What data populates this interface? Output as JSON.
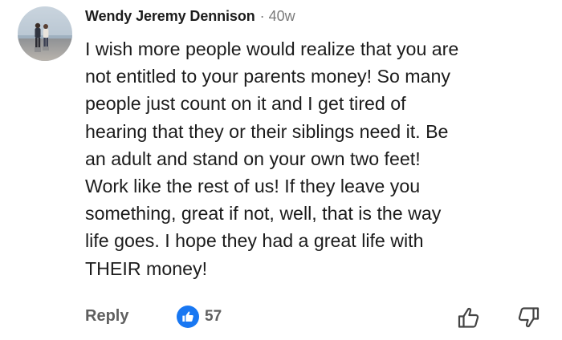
{
  "comment": {
    "author": "Wendy Jeremy Dennison",
    "separator": "·",
    "time": "40w",
    "text": "I wish more people would realize that you are\nnot entitled to your parents money!  So many\npeople just count on it and I get tired of\nhearing that they or their siblings need it.  Be\nan adult and stand on your own two feet!\nWork like the rest of us!  If they leave you\nsomething, great if not, well, that is the way\nlife goes.  I hope they had a great life with\nTHEIR money!"
  },
  "actions": {
    "reply_label": "Reply",
    "like_count": "57"
  },
  "icons": {
    "like_badge": "thumbs-up-icon",
    "upvote": "thumbs-up-outline-icon",
    "downvote": "thumbs-down-outline-icon"
  },
  "colors": {
    "like_badge": "#1877f2",
    "text": "#1c1c1c",
    "muted": "#5f5f5f"
  }
}
